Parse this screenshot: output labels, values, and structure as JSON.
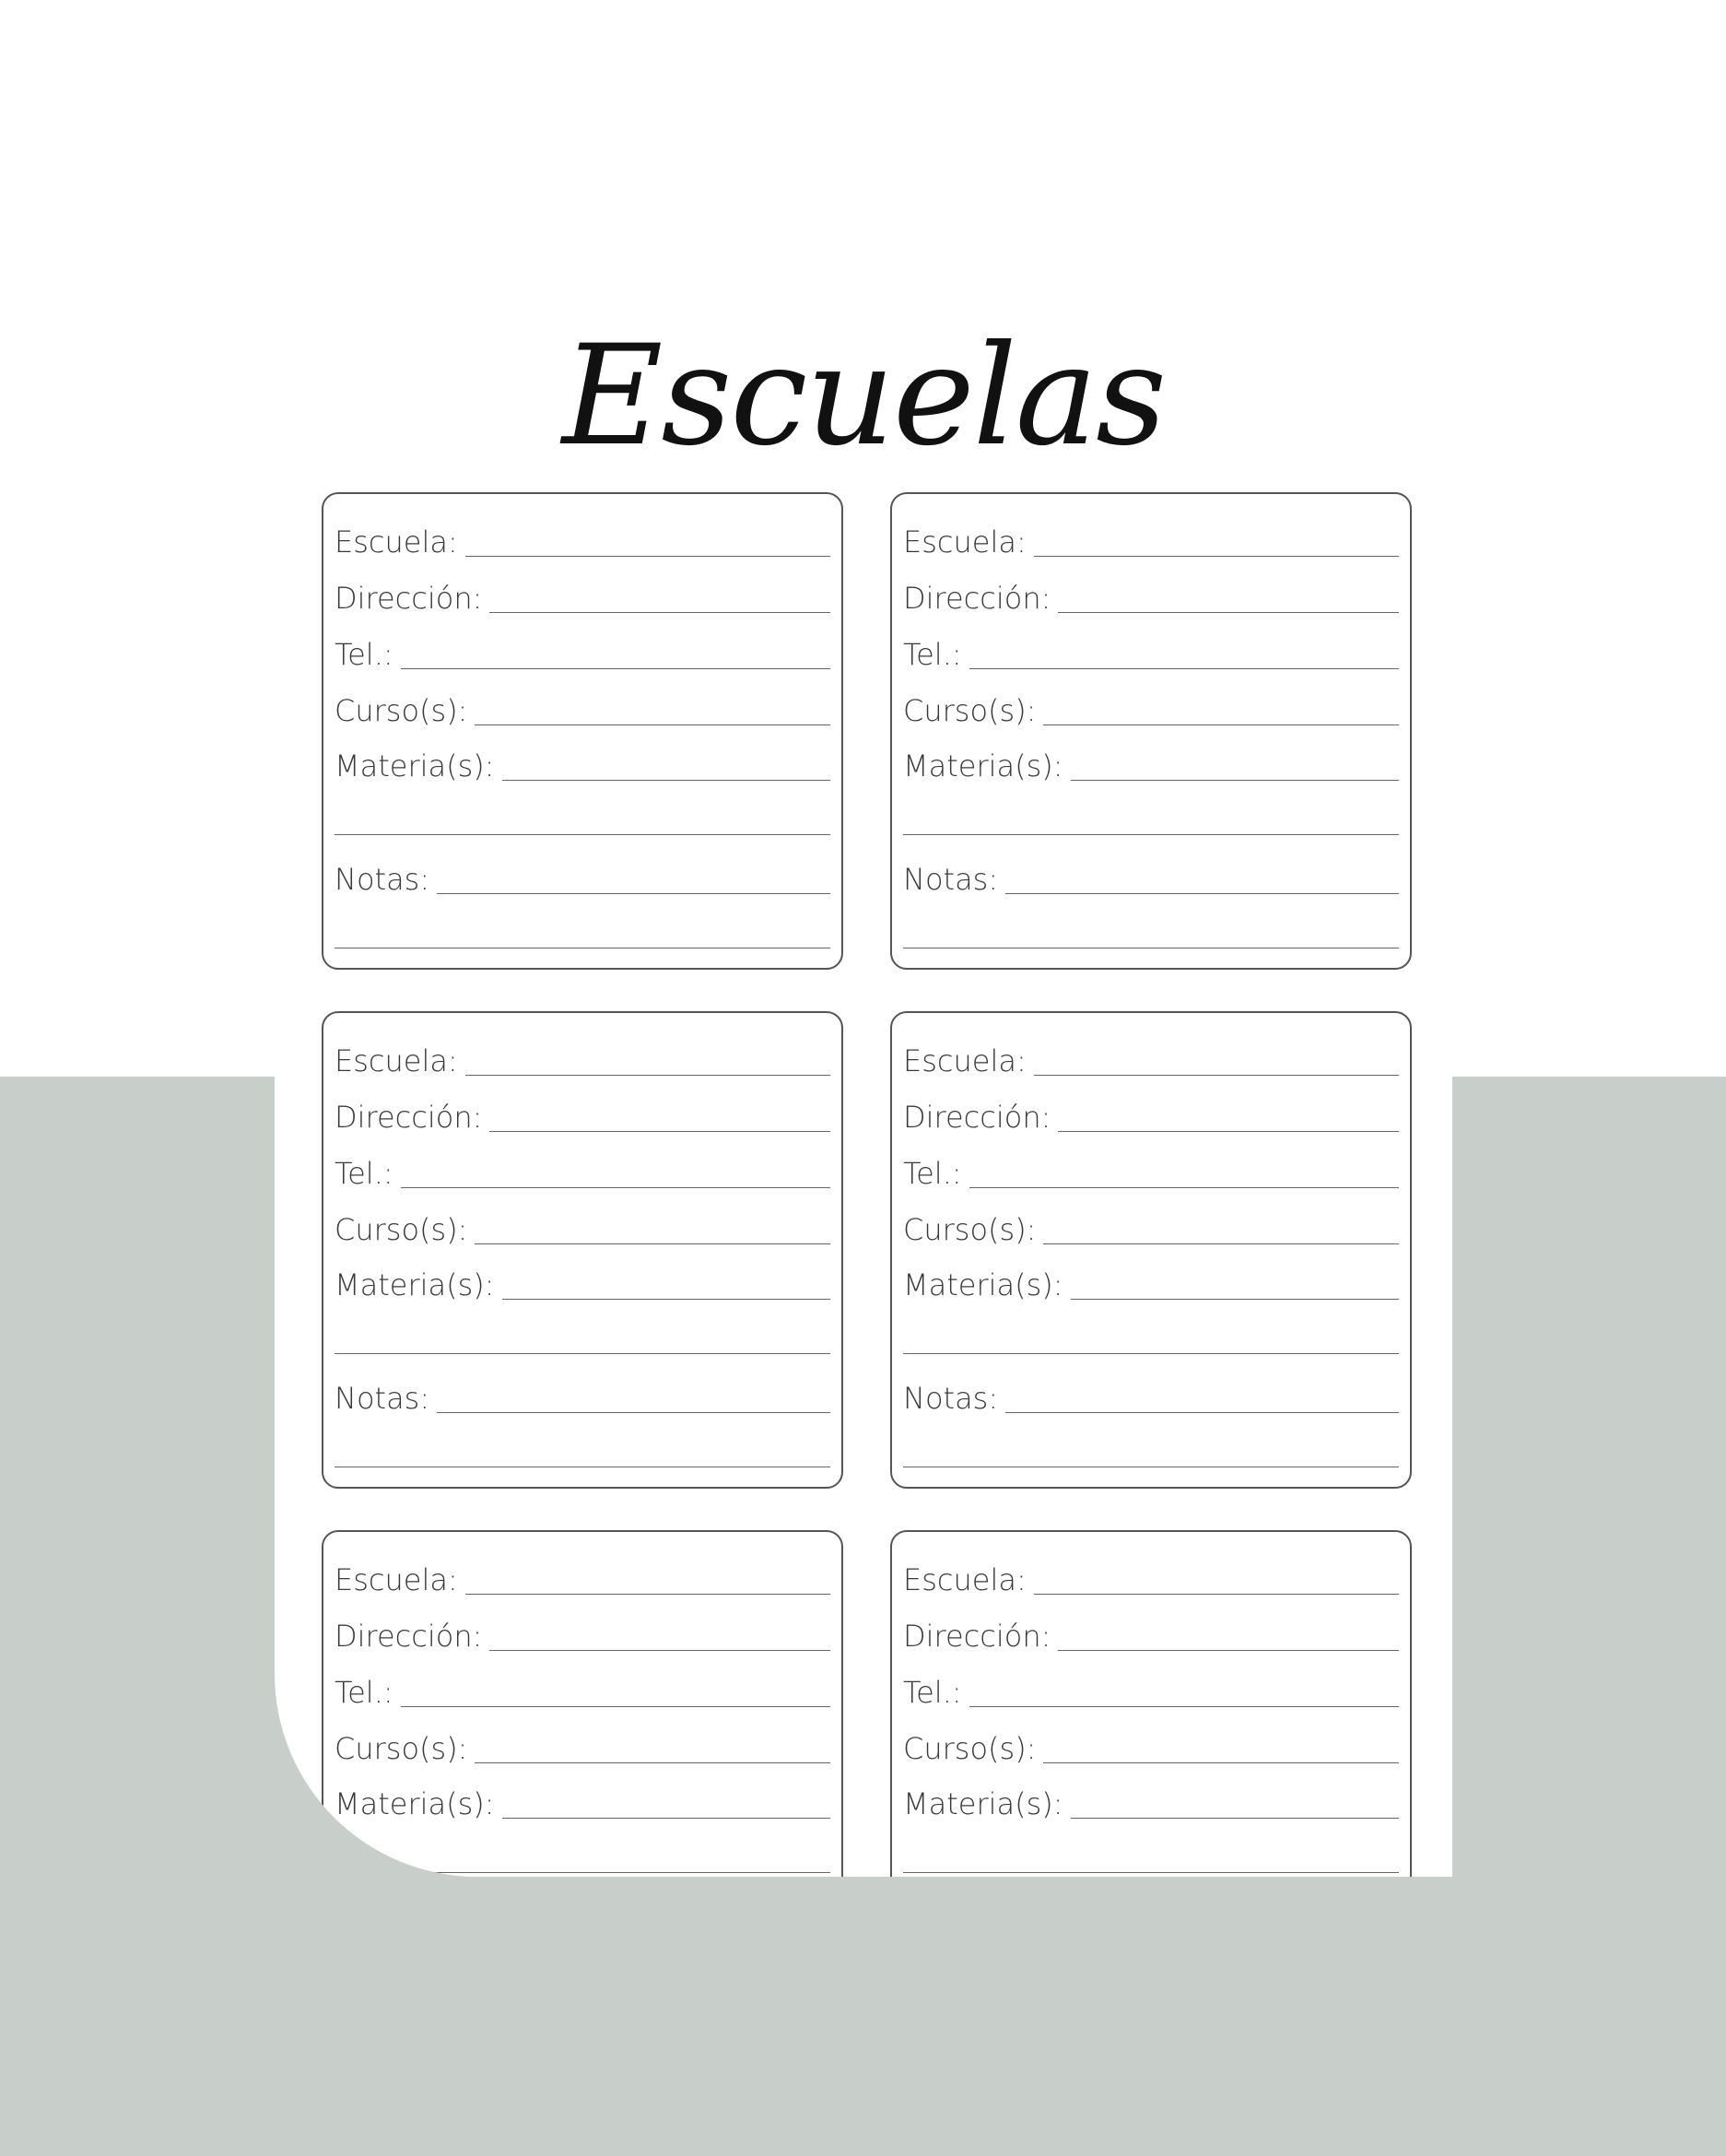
{
  "title": "Escuelas",
  "colors": {
    "background_band": "#c8ceca",
    "page": "#ffffff",
    "ink": "#333333"
  },
  "card": {
    "school_label": "Escuela:",
    "address_label": "Dirección:",
    "phone_label": "Tel.:",
    "courses_label": "Curso(s):",
    "subjects_label": "Materia(s):",
    "notes_label": "Notas:"
  }
}
